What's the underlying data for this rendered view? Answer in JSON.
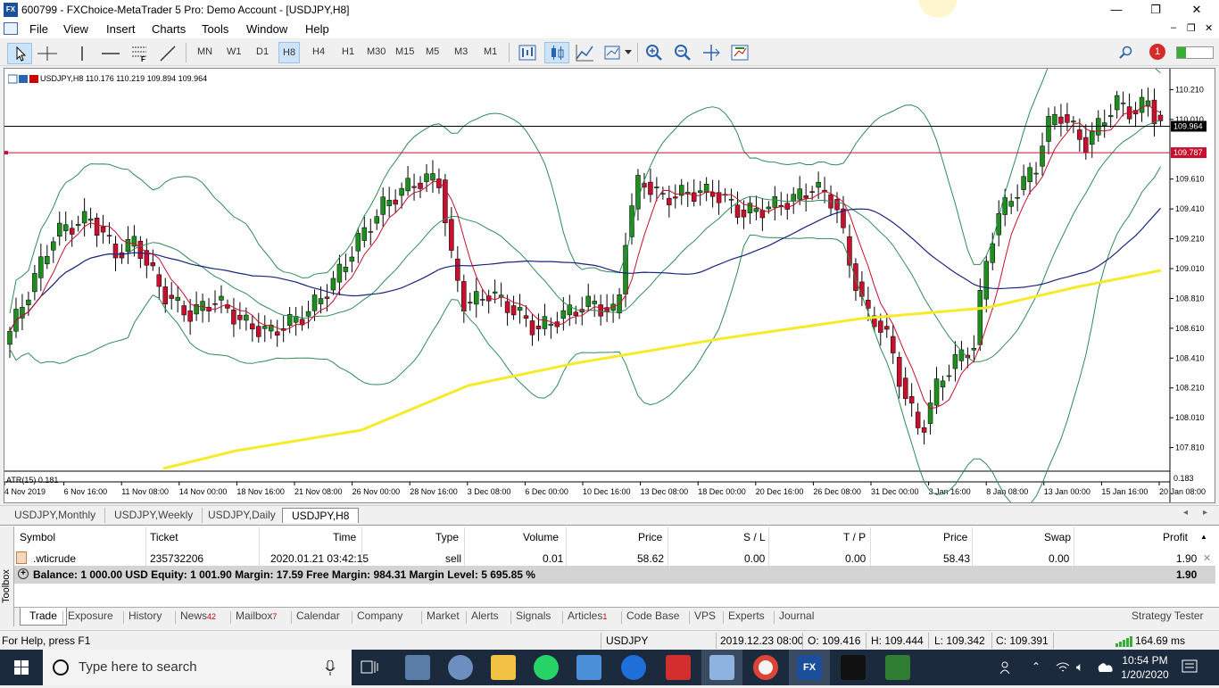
{
  "window": {
    "title": "600799 - FXChoice-MetaTrader 5 Pro: Demo Account - [USDJPY,H8]",
    "app_icon": "FX",
    "minimize": "—",
    "maximize": "❐",
    "close": "✕"
  },
  "menu": [
    "File",
    "View",
    "Insert",
    "Charts",
    "Tools",
    "Window",
    "Help"
  ],
  "timeframes": [
    "MN",
    "W1",
    "D1",
    "H8",
    "H4",
    "H1",
    "M30",
    "M15",
    "M5",
    "M3",
    "M1"
  ],
  "active_timeframe": "H8",
  "notification_count": "1",
  "chart": {
    "header": "USDJPY,H8  110.176 110.219 109.894 109.964",
    "indicator_label": "ATR(15) 0.181",
    "indicator_right": "0.183",
    "price_labels": [
      "110.210",
      "110.010",
      "109.610",
      "109.410",
      "109.210",
      "109.010",
      "108.810",
      "108.610",
      "108.410",
      "108.210",
      "108.010",
      "107.810"
    ],
    "current_price": "109.964",
    "hline_price": "109.787",
    "time_labels": [
      "4 Nov 2019",
      "6 Nov 16:00",
      "11 Nov 08:00",
      "14 Nov 00:00",
      "18 Nov 16:00",
      "21 Nov 08:00",
      "26 Nov 00:00",
      "28 Nov 16:00",
      "3 Dec 08:00",
      "6 Dec 00:00",
      "10 Dec 16:00",
      "13 Dec 08:00",
      "18 Dec 00:00",
      "20 Dec 16:00",
      "26 Dec 08:00",
      "31 Dec 00:00",
      "3 Jan 16:00",
      "8 Jan 08:00",
      "13 Jan 00:00",
      "15 Jan 16:00",
      "20 Jan 08:00"
    ],
    "colors": {
      "bull": "#1e8f1e",
      "bear": "#c8102e",
      "ma_red": "#c8102e",
      "ma_blue": "#1a237e",
      "ma_yellow": "#f5eb2a",
      "bands": "#2e8b57"
    }
  },
  "chart_tabs": [
    "USDJPY,Monthly",
    "USDJPY,Weekly",
    "USDJPY,Daily",
    "USDJPY,H8"
  ],
  "trade_table": {
    "headers": [
      "Symbol",
      "Ticket",
      "Time",
      "Type",
      "Volume",
      "Price",
      "S / L",
      "T / P",
      "Price",
      "Swap",
      "Profit"
    ],
    "row": [
      ".wticrude",
      "235732206",
      "2020.01.21 03:42:15",
      "sell",
      "0.01",
      "58.62",
      "0.00",
      "0.00",
      "58.43",
      "0.00",
      "1.90"
    ],
    "balance_line": "Balance: 1 000.00 USD  Equity: 1 001.90  Margin: 17.59  Free Margin: 984.31  Margin Level: 5 695.85 %",
    "balance_profit": "1.90"
  },
  "toolbox_label": "Toolbox",
  "bottom_tabs": [
    {
      "label": "Trade",
      "badge": ""
    },
    {
      "label": "Exposure",
      "badge": ""
    },
    {
      "label": "History",
      "badge": ""
    },
    {
      "label": "News",
      "badge": "42"
    },
    {
      "label": "Mailbox",
      "badge": "7"
    },
    {
      "label": "Calendar",
      "badge": ""
    },
    {
      "label": "Company",
      "badge": ""
    },
    {
      "label": "Market",
      "badge": ""
    },
    {
      "label": "Alerts",
      "badge": ""
    },
    {
      "label": "Signals",
      "badge": ""
    },
    {
      "label": "Articles",
      "badge": "1"
    },
    {
      "label": "Code Base",
      "badge": ""
    },
    {
      "label": "VPS",
      "badge": ""
    },
    {
      "label": "Experts",
      "badge": ""
    },
    {
      "label": "Journal",
      "badge": ""
    }
  ],
  "strategy_tester": "Strategy Tester",
  "status": {
    "help": "For Help, press F1",
    "symbol": "USDJPY",
    "datetime": "2019.12.23 08:00",
    "open": "O: 109.416",
    "high": "H: 109.444",
    "low": "L: 109.342",
    "close": "C: 109.391",
    "ping": "164.69 ms"
  },
  "taskbar": {
    "search_placeholder": "Type here to search",
    "time": "10:54 PM",
    "date": "1/20/2020"
  }
}
